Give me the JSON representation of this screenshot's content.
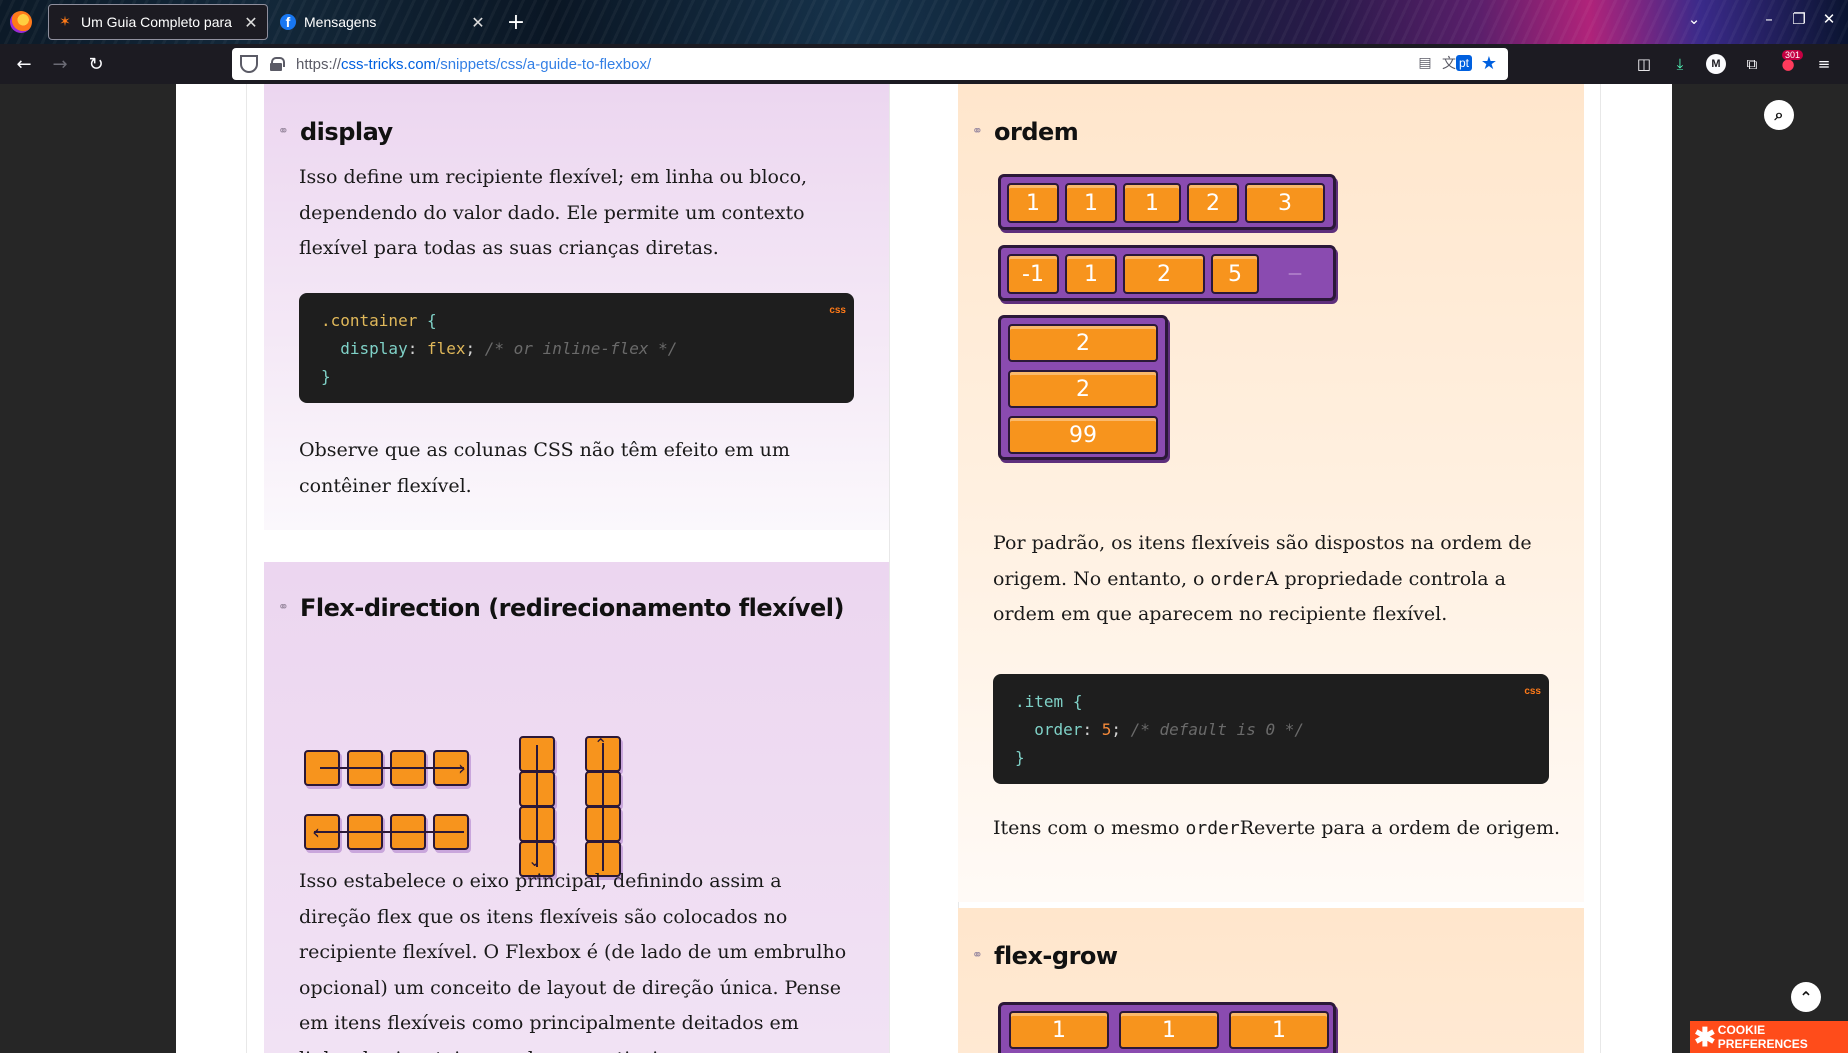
{
  "browser": {
    "tabs": [
      {
        "title": "Um Guia Completo para",
        "active": true,
        "favicon": "css-tricks-star-icon"
      },
      {
        "title": "Mensagens",
        "active": false,
        "favicon": "facebook-icon"
      }
    ],
    "url": {
      "scheme": "https://",
      "host": "css-tricks.com",
      "path": "/snippets/css/a-guide-to-flexbox/"
    },
    "translate_lang": "pt",
    "notification_count": "301"
  },
  "left": {
    "display": {
      "title": "display",
      "text": "Isso define um recipiente flexível; em linha ou bloco, dependendo do valor dado. Ele permite um contexto flexível para todas as suas crianças diretas.",
      "code_lang": "css",
      "code": {
        "selector": ".container",
        "prop": "display",
        "value": "flex",
        "comment": "/* or inline-flex */"
      },
      "note": "Observe que as colunas CSS não têm efeito em um contêiner flexível."
    },
    "flex_direction": {
      "title": "Flex-direction (redirecionamento flexível)",
      "text": "Isso estabelece o eixo principal, definindo assim a direção flex que os itens flexíveis são colocados no recipiente flexível. O Flexbox é (de lado de um embrulho opcional) um conceito de layout de direção única. Pense em itens flexíveis como principalmente deitados em linhas horizontais ou colunas verticais."
    }
  },
  "right": {
    "order": {
      "title": "ordem",
      "rows": [
        [
          "1",
          "1",
          "1",
          "2",
          "3"
        ],
        [
          "-1",
          "1",
          "2",
          "5",
          "—"
        ],
        [
          "2",
          "2",
          "99"
        ]
      ],
      "text_before": "Por padrão, os itens flexíveis são dispostos na ordem de origem. No entanto, o ",
      "text_code": "order",
      "text_after": "A propriedade controla a ordem em que aparecem no recipiente flexível.",
      "code_lang": "css",
      "code": {
        "selector": ".item",
        "prop": "order",
        "value": "5",
        "comment": "/* default is 0 */"
      },
      "note_before": "Itens com o mesmo ",
      "note_code": "order",
      "note_after": "Reverte para a ordem de origem."
    },
    "flex_grow": {
      "title": "flex-grow",
      "items": [
        "1",
        "1",
        "1"
      ]
    }
  },
  "cookie_label": "COOKIE PREFERENCES"
}
